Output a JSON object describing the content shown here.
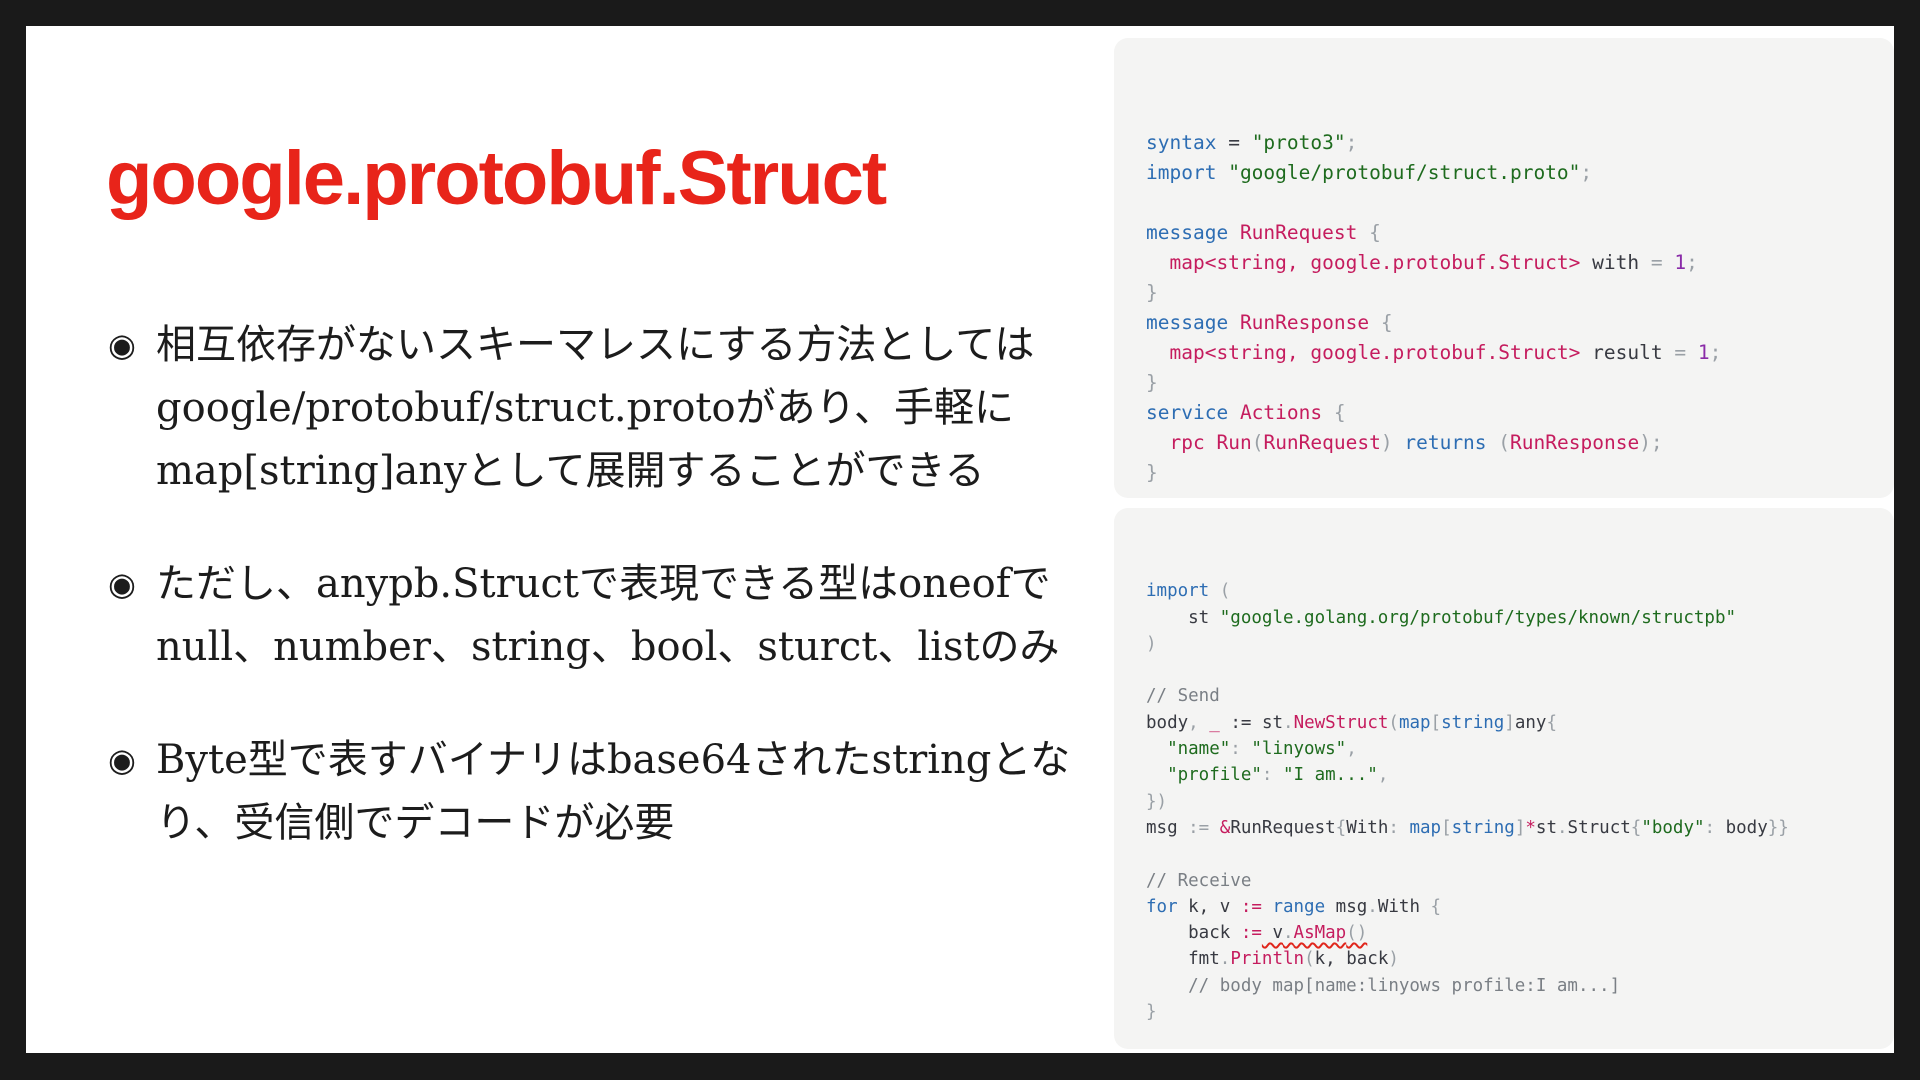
{
  "slide": {
    "title": "google.protobuf.Struct",
    "bullet_mark": "◉",
    "bullets": [
      "相互依存がないスキーマレスにする方法としては google/protobuf/struct.protoがあり、手軽に map[string]anyとして展開することができる",
      "ただし、anypb.Structで表現できる型はoneofでnull、number、string、bool、sturct、listのみ",
      "Byte型で表すバイナリはbase64されたstringとなり、受信側でデコードが必要"
    ]
  },
  "proto_code": {
    "l1": [
      "syntax",
      " = ",
      "\"proto3\"",
      ";"
    ],
    "l2": [
      "import",
      " ",
      "\"google/protobuf/struct.proto\"",
      ";"
    ],
    "l4": [
      "message",
      " ",
      "RunRequest",
      " {"
    ],
    "l5": [
      "  ",
      "map<string, google.protobuf.Struct>",
      " with ",
      "=",
      " ",
      "1",
      ";"
    ],
    "l6": [
      "}"
    ],
    "l7": [
      "message",
      " ",
      "RunResponse",
      " {"
    ],
    "l8": [
      "  ",
      "map<string, google.protobuf.Struct>",
      " result ",
      "=",
      " ",
      "1",
      ";"
    ],
    "l9": [
      "}"
    ],
    "l10": [
      "service",
      " ",
      "Actions",
      " {"
    ],
    "l11": [
      "  ",
      "rpc",
      " ",
      "Run",
      "(",
      "RunRequest",
      ")",
      " ",
      "returns",
      " ",
      "(",
      "RunResponse",
      ");"
    ],
    "l12": [
      "}"
    ]
  },
  "go_code": {
    "l1": [
      "import",
      " ("
    ],
    "l2": [
      "    st ",
      "\"google.golang.org/protobuf/types/known/structpb\""
    ],
    "l3": [
      ")"
    ],
    "l5": [
      "// Send"
    ],
    "l6": [
      "body",
      ", ",
      "_",
      " := ",
      "st",
      ".",
      "NewStruct",
      "(",
      "map",
      "[",
      "string",
      "]",
      "any",
      "{"
    ],
    "l7": [
      "  ",
      "\"name\"",
      ": ",
      "\"linyows\"",
      ","
    ],
    "l8": [
      "  ",
      "\"profile\"",
      ": ",
      "\"I am...\"",
      ","
    ],
    "l9": [
      "})"
    ],
    "l10": [
      "msg",
      " := ",
      "&",
      "RunRequest",
      "{",
      "With",
      ": ",
      "map",
      "[",
      "string",
      "]",
      "*",
      "st",
      ".",
      "Struct",
      "{",
      "\"body\"",
      ": ",
      "body",
      "}}"
    ],
    "l12": [
      "// Receive"
    ],
    "l13": [
      "for",
      " k, v ",
      ":=",
      " ",
      "range",
      " msg",
      ".",
      "With",
      " {"
    ],
    "l14": [
      "    back ",
      ":=",
      " v",
      ".",
      "AsMap",
      "()"
    ],
    "l15": [
      "    fmt",
      ".",
      "Println",
      "(",
      "k, back",
      ")"
    ],
    "l16": [
      "    // body map[name:linyows profile:I am...]"
    ],
    "l17": [
      "}"
    ]
  }
}
